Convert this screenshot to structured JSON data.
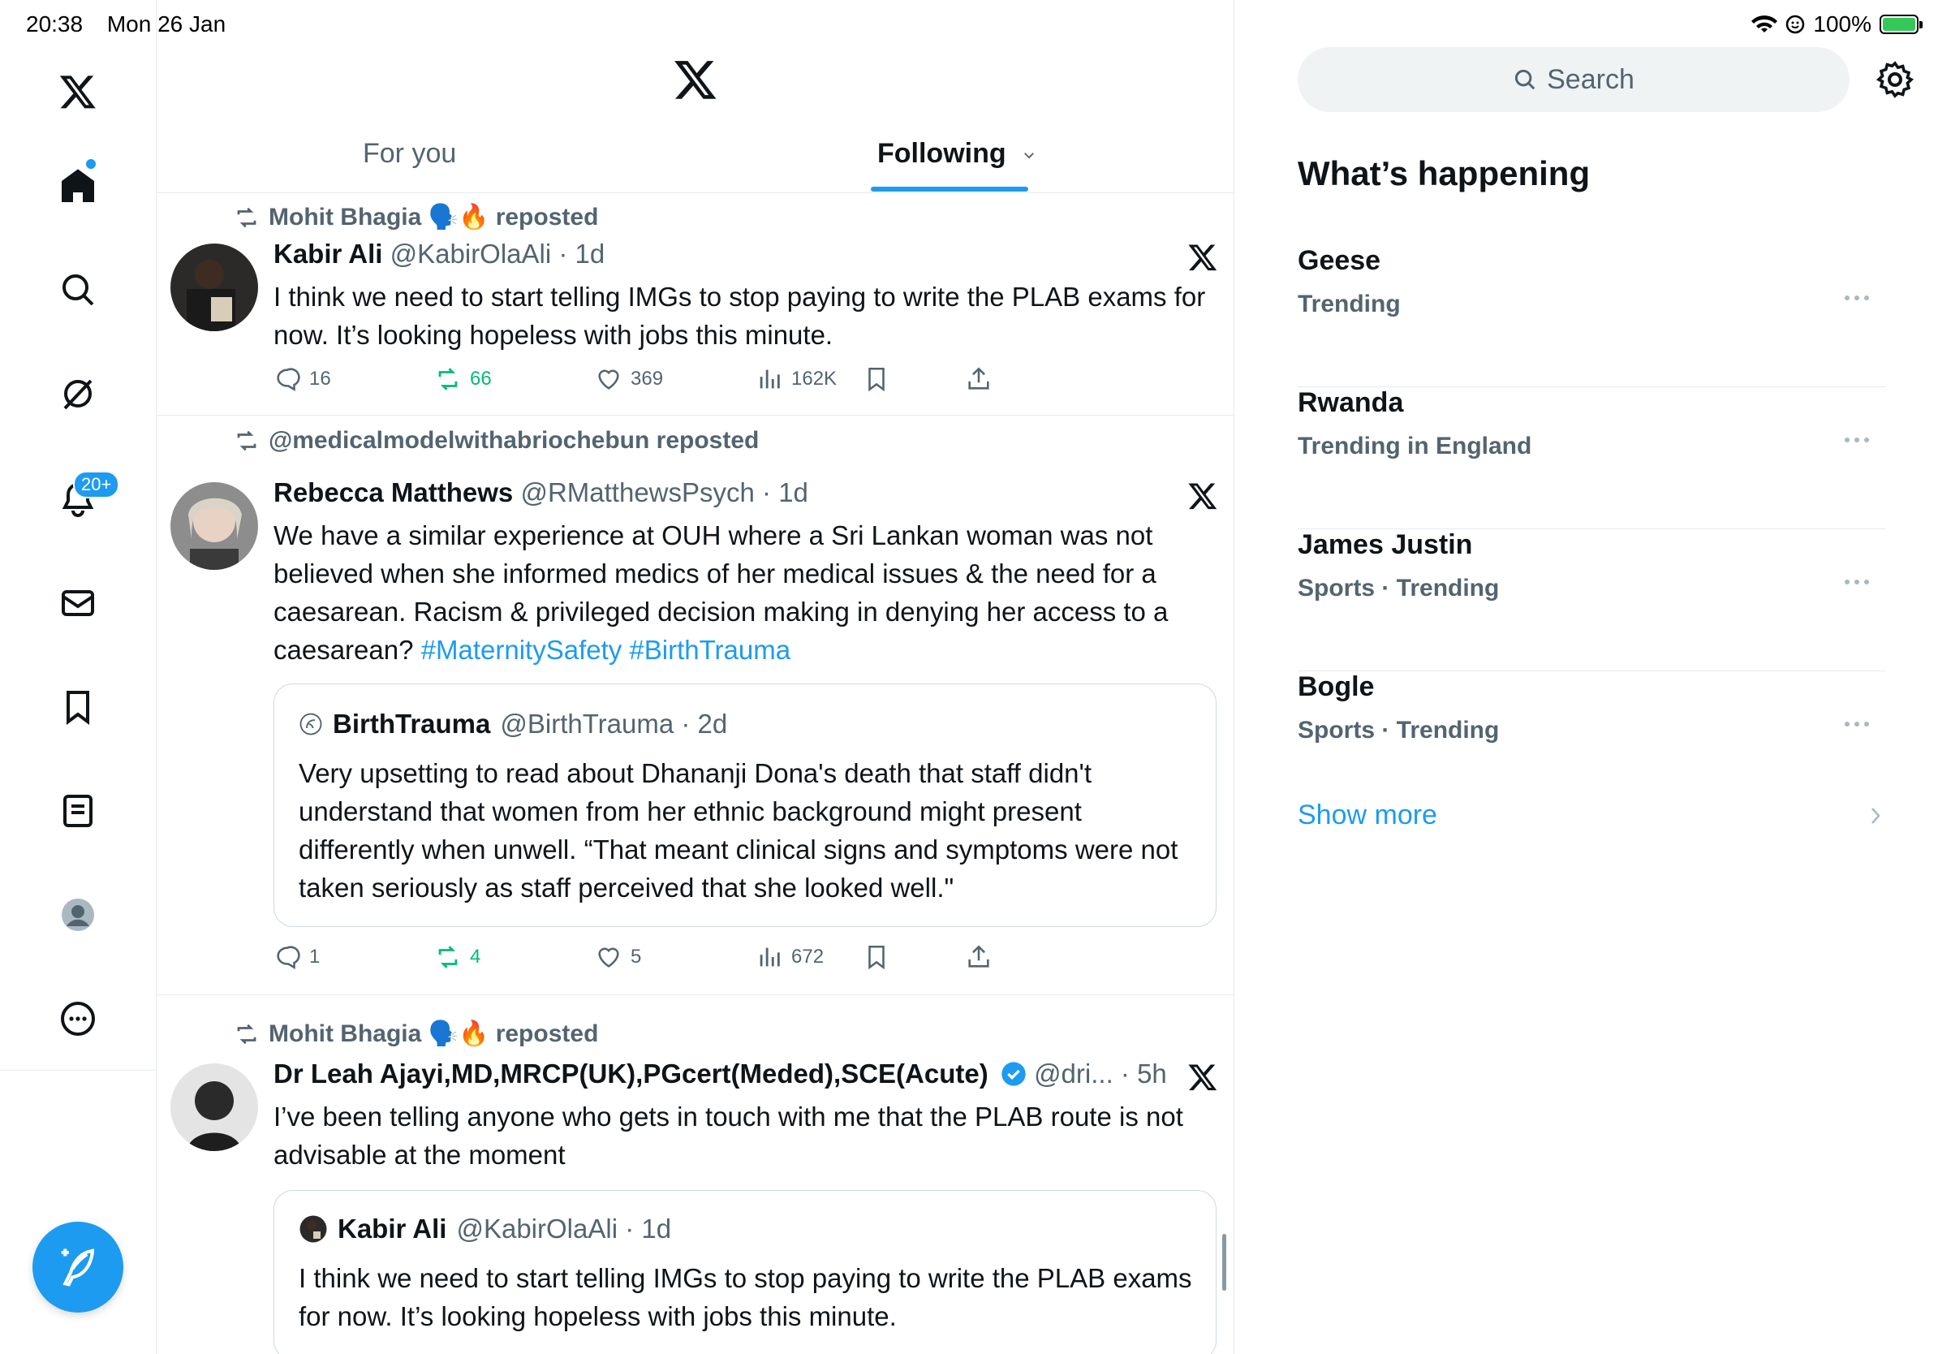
{
  "status_bar": {
    "time": "20:38",
    "date": "Mon 26 Jan",
    "battery": "100%"
  },
  "nav": {
    "notifications_badge": "20+",
    "icons": [
      "x-logo-icon",
      "home-icon",
      "search-icon",
      "grok-icon",
      "notifications-icon",
      "messages-icon",
      "bookmarks-icon",
      "lists-icon",
      "profile-icon",
      "more-icon",
      "compose-icon"
    ]
  },
  "tabs": {
    "for_you": "For you",
    "following": "Following"
  },
  "posts": [
    {
      "reposted_by": "Mohit Bhagia 🗣️🔥 reposted",
      "name": "Kabir Ali",
      "handle_time": "@KabirOlaAli · 1d",
      "text": "I think we need to start telling IMGs to stop paying to write the PLAB exams for now. It’s looking hopeless with jobs this minute.",
      "replies": "16",
      "reposts": "66",
      "likes": "369",
      "views": "162K"
    },
    {
      "reposted_by": "@medicalmodelwithabriochebun reposted",
      "name": "Rebecca Matthews",
      "handle_time": "@RMatthewsPsych · 1d",
      "text": "We have a similar experience at OUH where a Sri Lankan woman was not believed when she informed medics of her medical issues & the need for a caesarean. Racism & privileged decision making in denying her access to a caesarean?",
      "hashtags": "#MaternitySafety #BirthTrauma",
      "quote": {
        "name": "BirthTrauma",
        "handle_time": "@BirthTrauma · 2d",
        "text": "Very upsetting to read about Dhananji Dona's death that staff didn't understand that women from her ethnic background might present differently when unwell. “That meant clinical signs and symptoms were not taken seriously as staff perceived that she looked well.\""
      },
      "replies": "1",
      "reposts": "4",
      "likes": "5",
      "views": "672"
    },
    {
      "reposted_by": "Mohit Bhagia 🗣️🔥 reposted",
      "name": "Dr Leah Ajayi,MD,MRCP(UK),PGcert(Meded),SCE(Acute)",
      "handle_time": "@dri... · 5h",
      "text": "I’ve been telling anyone who gets in touch with me that the PLAB route is not advisable at the moment",
      "quote": {
        "name": "Kabir Ali",
        "handle_time": "@KabirOlaAli · 1d",
        "text": "I think we need to start telling IMGs to stop paying to write the PLAB exams for now. It’s looking hopeless with jobs this minute."
      }
    }
  ],
  "sidebar": {
    "search_placeholder": "Search",
    "title": "What’s happening",
    "trends": [
      {
        "name": "Geese",
        "meta": "Trending"
      },
      {
        "name": "Rwanda",
        "meta": "Trending in England"
      },
      {
        "name": "James Justin",
        "meta": "Sports · Trending"
      },
      {
        "name": "Bogle",
        "meta": "Sports · Trending"
      }
    ],
    "show_more": "Show more"
  },
  "colors": {
    "accent": "#1d9bf0",
    "repost_green": "#00ba7c",
    "muted": "#536471"
  }
}
